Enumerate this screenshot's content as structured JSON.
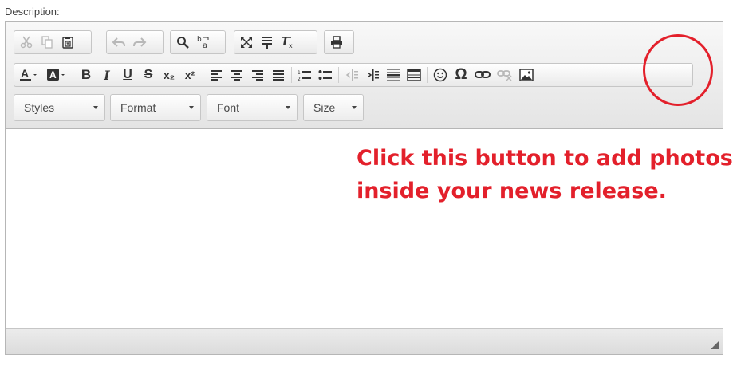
{
  "field_label": "Description:",
  "toolbar": {
    "row1": [
      {
        "name": "cut-icon",
        "enabled": false
      },
      {
        "name": "copy-icon",
        "enabled": false
      },
      {
        "name": "paste-text-icon",
        "enabled": true
      },
      {
        "name": "undo-icon",
        "enabled": false
      },
      {
        "name": "redo-icon",
        "enabled": false
      },
      {
        "name": "find-icon",
        "enabled": true
      },
      {
        "name": "replace-icon",
        "enabled": true
      },
      {
        "name": "maximize-icon",
        "enabled": true
      },
      {
        "name": "show-blocks-icon",
        "enabled": true
      },
      {
        "name": "remove-format-icon",
        "enabled": true
      },
      {
        "name": "print-icon",
        "enabled": true
      }
    ],
    "row2": [
      {
        "name": "text-color-icon"
      },
      {
        "name": "background-color-icon"
      },
      {
        "name": "bold-icon",
        "glyph": "B"
      },
      {
        "name": "italic-icon",
        "glyph": "I"
      },
      {
        "name": "underline-icon",
        "glyph": "U"
      },
      {
        "name": "strikethrough-icon",
        "glyph": "S"
      },
      {
        "name": "subscript-icon",
        "glyph": "x₂"
      },
      {
        "name": "superscript-icon",
        "glyph": "x²"
      },
      {
        "name": "align-left-icon"
      },
      {
        "name": "align-center-icon"
      },
      {
        "name": "align-right-icon"
      },
      {
        "name": "justify-icon"
      },
      {
        "name": "numbered-list-icon"
      },
      {
        "name": "bulleted-list-icon"
      },
      {
        "name": "outdent-icon",
        "enabled": false
      },
      {
        "name": "indent-icon"
      },
      {
        "name": "horizontal-line-icon"
      },
      {
        "name": "table-icon"
      },
      {
        "name": "smiley-icon"
      },
      {
        "name": "special-char-icon",
        "glyph": "Ω"
      },
      {
        "name": "link-icon"
      },
      {
        "name": "unlink-icon",
        "enabled": false
      },
      {
        "name": "image-icon"
      }
    ],
    "combos": {
      "styles": "Styles",
      "format": "Format",
      "font": "Font",
      "size": "Size"
    }
  },
  "annotation": {
    "line1": "Click this button to add photos",
    "line2": "inside your news release."
  },
  "colors": {
    "annotation": "#e3202b",
    "circle": "#e3202b"
  }
}
